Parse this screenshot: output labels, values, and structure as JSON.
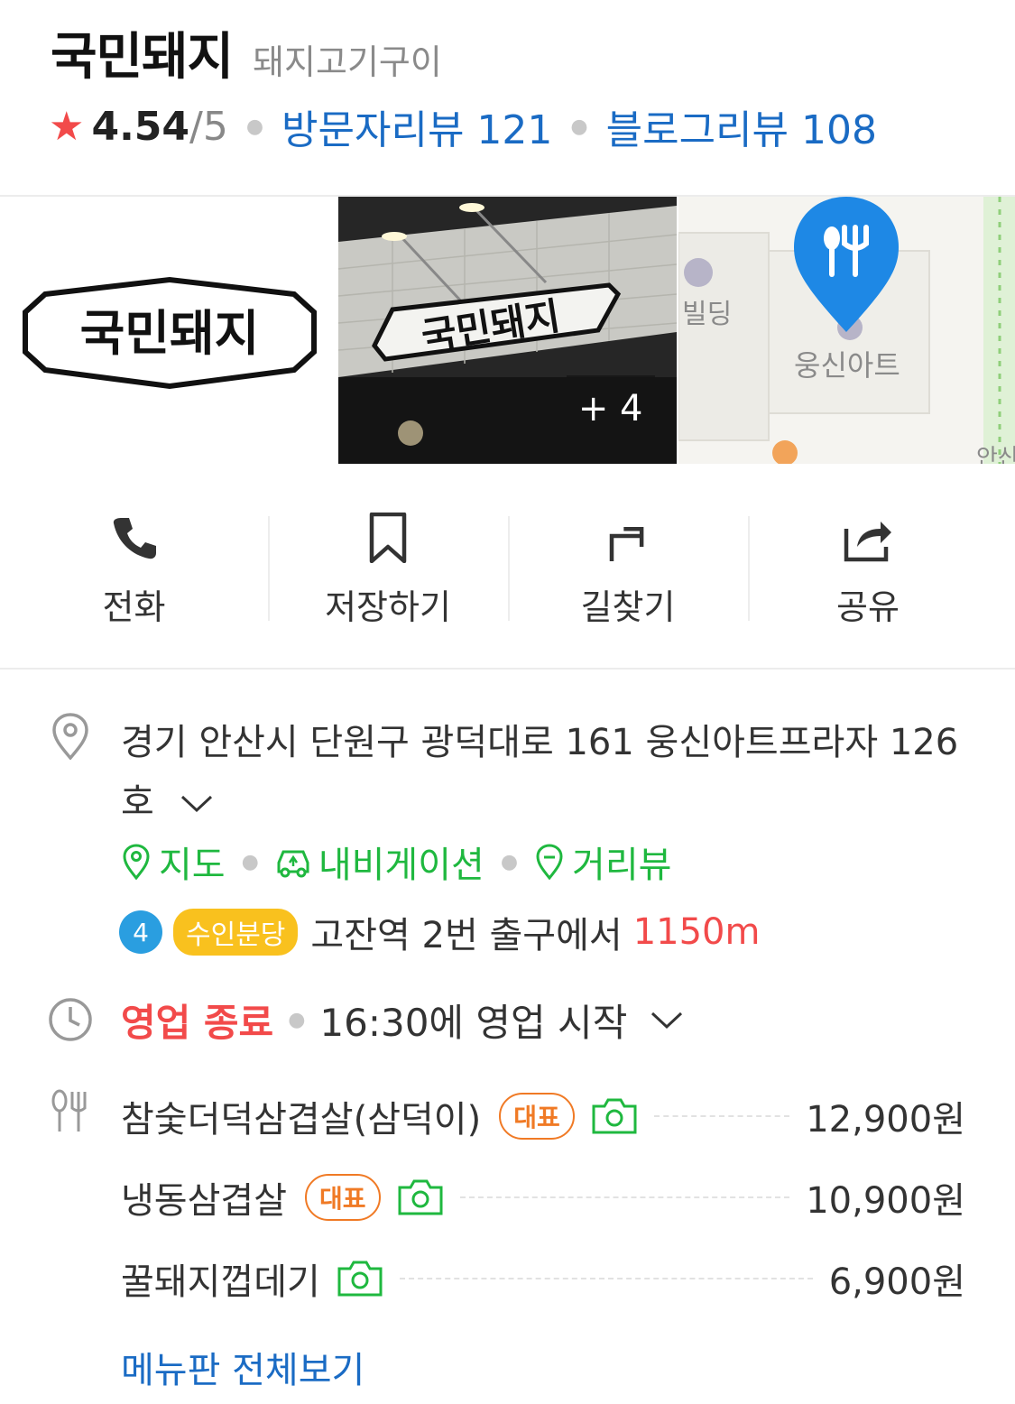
{
  "place": {
    "name": "국민돼지",
    "category": "돼지고기구이",
    "rating": "4.54",
    "rating_max": "/5",
    "visitor_review": "방문자리뷰 121",
    "blog_review": "블로그리뷰 108"
  },
  "photos": {
    "logo_text": "국민돼지",
    "sign_text": "국민돼지",
    "more_count": "+ 4",
    "map_labels": [
      "빌딩",
      "웅신아트",
      "안산"
    ]
  },
  "actions": [
    {
      "label": "전화",
      "icon": "phone-icon"
    },
    {
      "label": "저장하기",
      "icon": "bookmark-icon"
    },
    {
      "label": "길찾기",
      "icon": "directions-icon"
    },
    {
      "label": "공유",
      "icon": "share-icon"
    }
  ],
  "address": {
    "text": "경기 안산시 단원구 광덕대로 161 웅신아트프라자 126호",
    "map_link": "지도",
    "navi_link": "내비게이션",
    "street_link": "거리뷰"
  },
  "subway": {
    "line_number": "4",
    "line_name": "수인분당",
    "station": "고잔역 2번 출구에서",
    "distance": "1150m"
  },
  "hours": {
    "status": "영업 종료",
    "next": "16:30에 영업 시작"
  },
  "menu": {
    "items": [
      {
        "name": "참숯더덕삼겹살(삼덕이)",
        "badge": "대표",
        "price": "12,900원"
      },
      {
        "name": "냉동삼겹살",
        "badge": "대표",
        "price": "10,900원"
      },
      {
        "name": "꿀돼지껍데기",
        "badge": "",
        "price": "6,900원"
      }
    ],
    "view_all": "메뉴판 전체보기"
  },
  "colors": {
    "link_blue": "#1a6bc4",
    "green": "#1fb83f",
    "red": "#f24a4a",
    "orange": "#f07a25",
    "line4": "#2a9ee0",
    "suin_bundang": "#f9c11e"
  }
}
